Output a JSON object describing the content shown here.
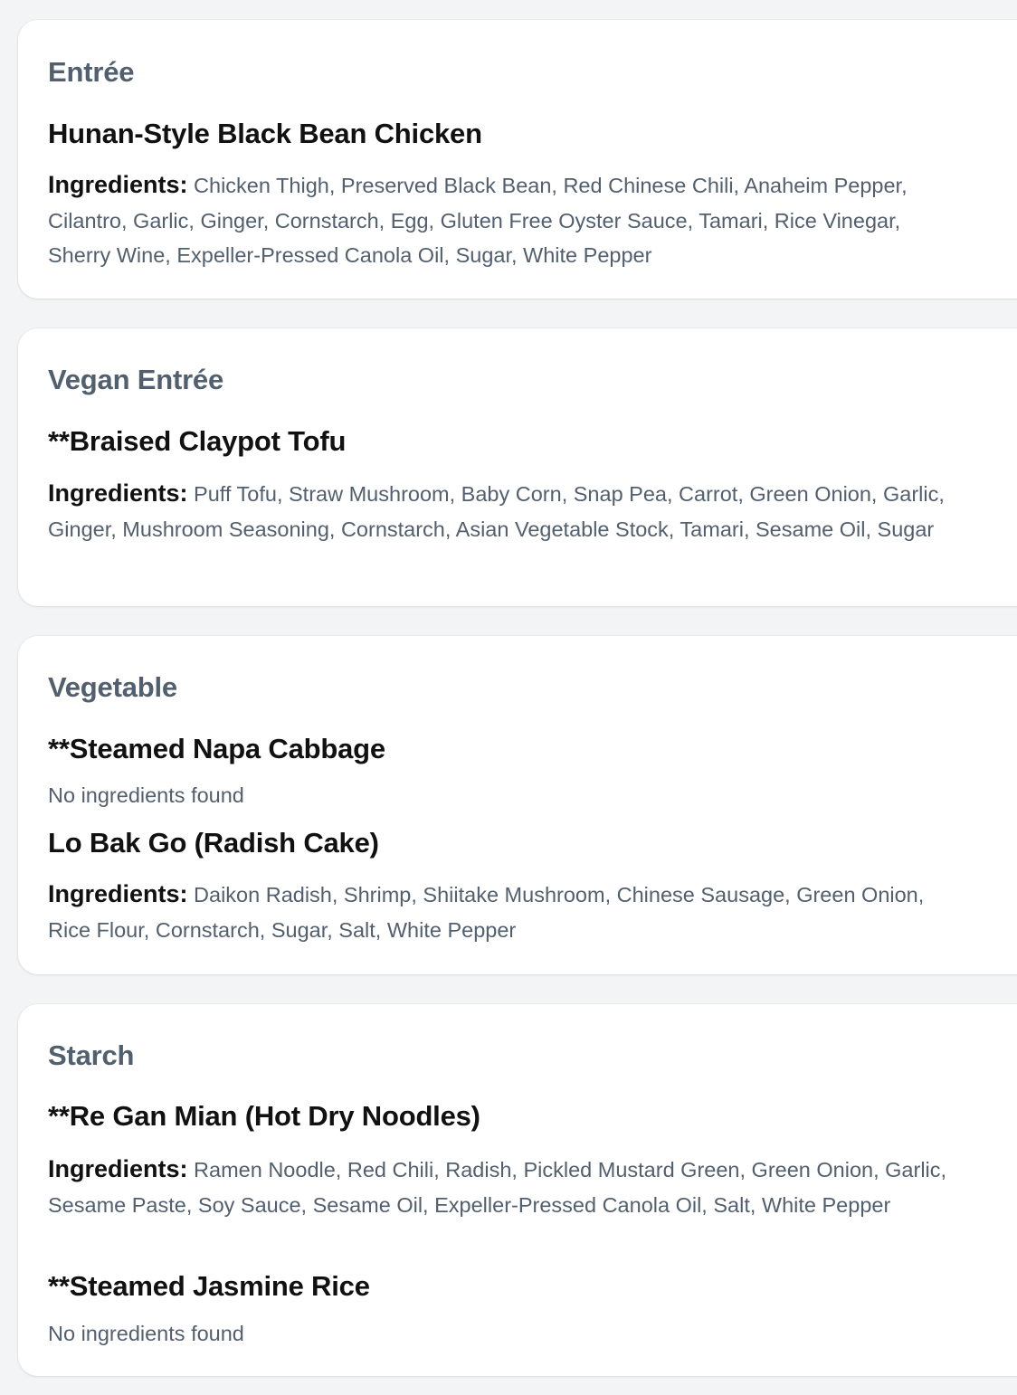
{
  "ingredients_label": "Ingredients:",
  "cards": [
    {
      "category": "Entrée",
      "dishes": [
        {
          "name": "Hunan-Style Black Bean Chicken",
          "ingredients": "Chicken Thigh, Preserved Black Bean, Red Chinese Chili, Anaheim Pepper, Cilantro, Garlic, Ginger, Cornstarch, Egg, Gluten Free Oyster Sauce, Tamari, Rice Vinegar, Sherry Wine, Expeller-Pressed Canola Oil, Sugar, White Pepper"
        }
      ]
    },
    {
      "category": "Vegan Entrée",
      "dishes": [
        {
          "name": "**Braised Claypot Tofu",
          "ingredients": "Puff Tofu, Straw Mushroom, Baby Corn, Snap Pea, Carrot, Green Onion, Garlic, Ginger, Mushroom Seasoning, Cornstarch, Asian Vegetable Stock, Tamari, Sesame Oil, Sugar"
        }
      ]
    },
    {
      "category": "Vegetable",
      "dishes": [
        {
          "name": "**Steamed Napa Cabbage",
          "no_ingredients": "No ingredients found"
        },
        {
          "name": "Lo Bak Go (Radish Cake)",
          "ingredients": "Daikon Radish, Shrimp, Shiitake Mushroom, Chinese Sausage, Green Onion, Rice Flour, Cornstarch, Sugar, Salt, White Pepper"
        }
      ]
    },
    {
      "category": "Starch",
      "dishes": [
        {
          "name": "**Re Gan Mian (Hot Dry Noodles)",
          "ingredients": "Ramen Noodle, Red Chili, Radish, Pickled Mustard Green, Green Onion, Garlic, Sesame Paste, Soy Sauce, Sesame Oil, Expeller-Pressed Canola Oil, Salt, White Pepper"
        },
        {
          "name": "**Steamed Jasmine Rice",
          "no_ingredients": "No ingredients found"
        }
      ]
    }
  ]
}
